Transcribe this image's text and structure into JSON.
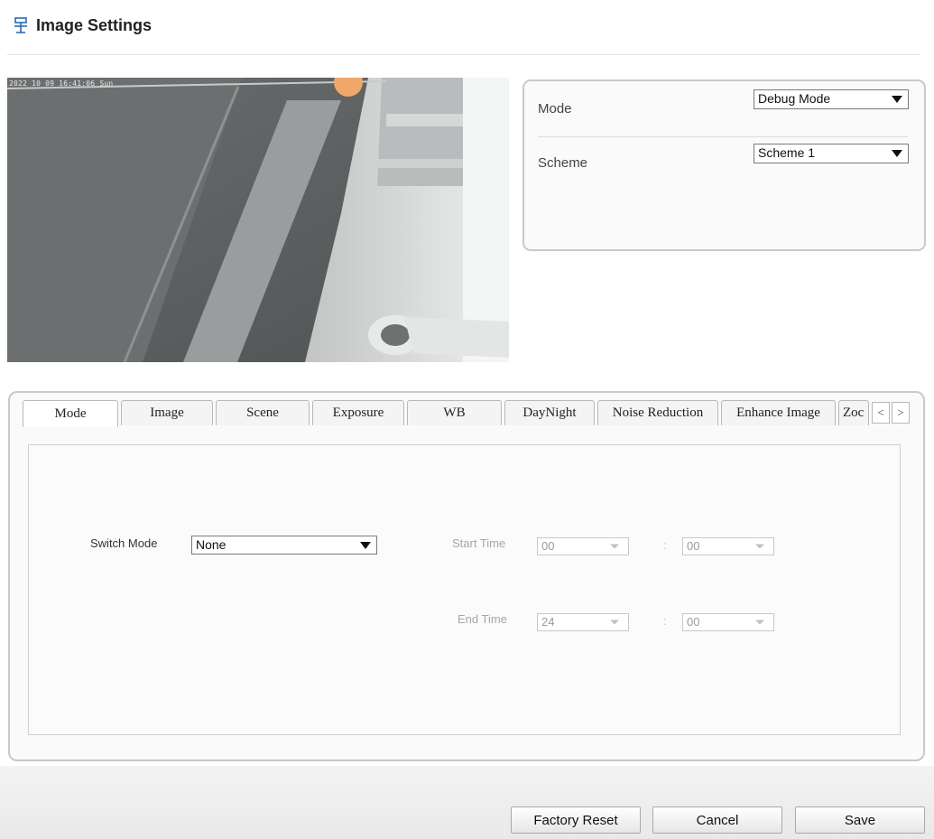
{
  "header": {
    "title": "Image Settings",
    "icon": "settings-pin-icon"
  },
  "video": {
    "osd_text": "2022 10 09 16:41:06 Sun"
  },
  "mode_panel": {
    "mode_label": "Mode",
    "mode_value": "Debug Mode",
    "scheme_label": "Scheme",
    "scheme_value": "Scheme 1"
  },
  "tabs": [
    {
      "label": "Mode",
      "active": true
    },
    {
      "label": "Image"
    },
    {
      "label": "Scene"
    },
    {
      "label": "Exposure"
    },
    {
      "label": "WB"
    },
    {
      "label": "DayNight"
    },
    {
      "label": "Noise Reduction"
    },
    {
      "label": "Enhance Image"
    },
    {
      "label": "Zoc"
    }
  ],
  "tab_scroll": {
    "prev": "<",
    "next": ">"
  },
  "mode_tab": {
    "switch_mode_label": "Switch Mode",
    "switch_mode_value": "None",
    "start_time_label": "Start Time",
    "start_hour": "00",
    "start_minute": "00",
    "end_time_label": "End Time",
    "end_hour": "24",
    "end_minute": "00",
    "colon": ":"
  },
  "buttons": {
    "factory_reset": "Factory Reset",
    "cancel": "Cancel",
    "save": "Save"
  }
}
